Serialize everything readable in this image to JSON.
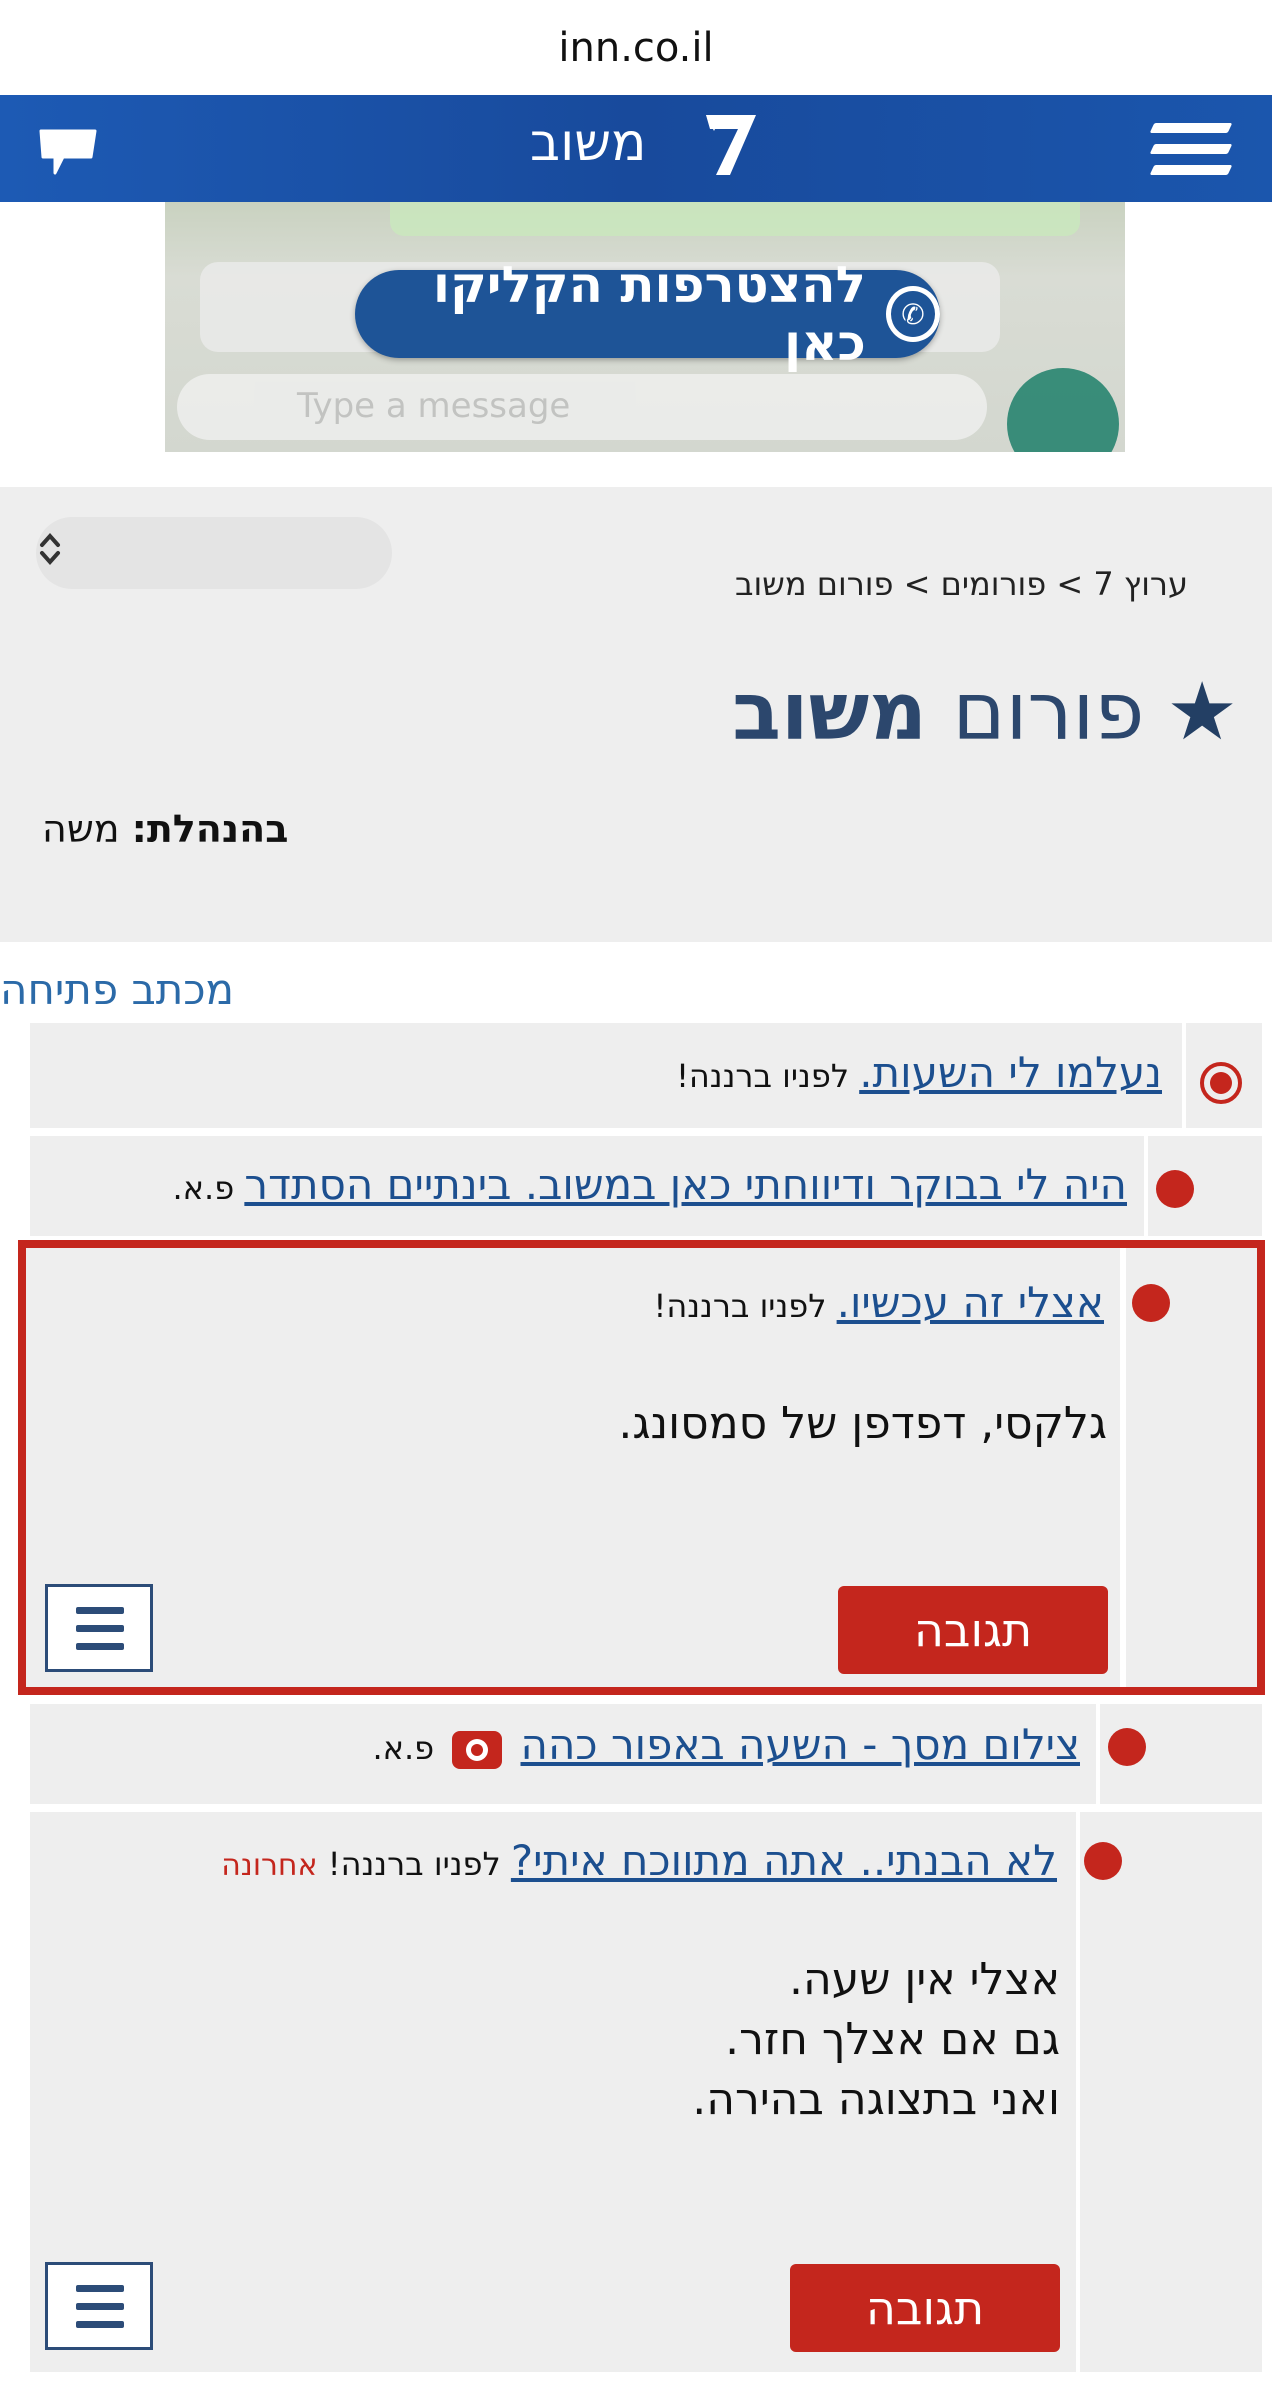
{
  "browser": {
    "url": "inn.co.il"
  },
  "nav": {
    "title": "משוב"
  },
  "ad": {
    "cta": "להצטרפות הקליקו כאן",
    "placeholder": "Type a message"
  },
  "breadcrumb": "ערוץ 7 > פורומים > פורום משוב",
  "forum": {
    "title_light": "פורום",
    "title_bold": "משוב",
    "moderator_label": "בהנהלת:",
    "moderator_name": "משה"
  },
  "opening_link": "מכתב פתיחה",
  "posts": [
    {
      "title": "נעלמו לי השעות.",
      "meta": "לפניו ברננה!"
    },
    {
      "title": "היה לי בבוקר ודיווחתי כאן במשוב. בינתיים הסתדר",
      "meta": "פ.א."
    },
    {
      "title": "אצלי זה עכשיו.",
      "meta": "לפניו ברננה!",
      "body": "גלקסי, דפדפן של סמסונג.",
      "reply": "תגובה"
    },
    {
      "title": "צילום מסך - השעה באפור כהה",
      "meta": "פ.א."
    },
    {
      "title": "לא הבנתי.. אתה מתווכח איתי?",
      "meta": "לפניו ברננה!",
      "tag": "אחרונה",
      "body_lines": [
        "אצלי אין שעה.",
        "גם אם אצלך חזר.",
        "ואני בתצוגה בהירה."
      ],
      "reply": "תגובה"
    }
  ],
  "colors": {
    "brand_blue": "#1d5ab4",
    "accent_red": "#c4261d",
    "link_blue": "#1c4f8f"
  },
  "icons": [
    "menu-icon",
    "logo-7-icon",
    "chat-icon",
    "whatsapp-icon",
    "star-icon",
    "camera-icon",
    "hamburger-icon"
  ]
}
